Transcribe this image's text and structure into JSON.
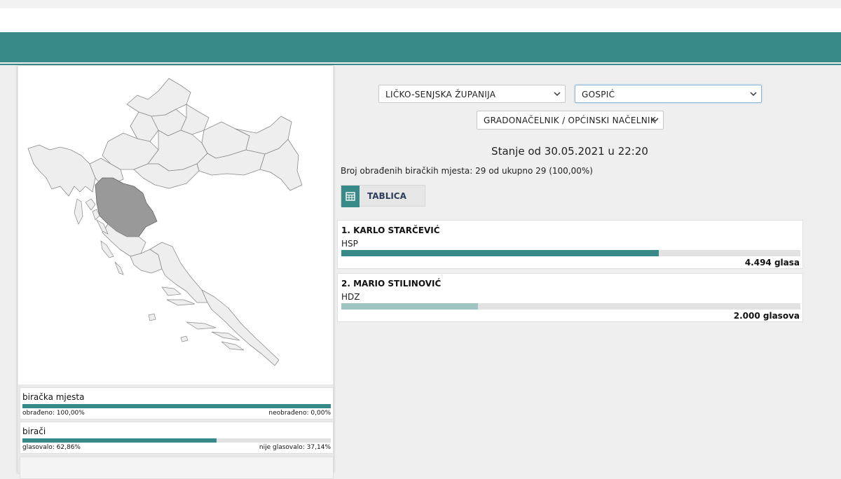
{
  "header": {
    "accent": "#378a87"
  },
  "filters": {
    "county": "LIČKO-SENJSKA ŽUPANIJA",
    "municipality": "GOSPIĆ",
    "election_type": "GRADONAČELNIK / OPĆINSKI NAČELNIK"
  },
  "status": {
    "as_of": "Stanje od 30.05.2021 u 22:20",
    "processed": "Broj obrađenih biračkih mjesta: 29 od ukupno 29 (100,00%)"
  },
  "view_toggle": {
    "label": "TABLICA",
    "icon": "table-icon"
  },
  "candidates": [
    {
      "name": "1. KARLO STARČEVIĆ",
      "party": "HSP",
      "votes": "4.494 glasa",
      "share": 0.692,
      "color": "#378a87"
    },
    {
      "name": "2. MARIO STILINOVIĆ",
      "party": "HDZ",
      "votes": "2.000 glasova",
      "share": 0.297,
      "color": "#9fc5c3"
    }
  ],
  "map": {
    "highlighted_region_color": "#999999",
    "region_color": "#eeeeee"
  },
  "stats": {
    "polling_stations": {
      "title": "biračka mjesta",
      "left": "obrađeno: 100,00%",
      "right": "neobrađeno: 0,00%",
      "fraction": 1.0
    },
    "voters": {
      "title": "birači",
      "left": "glasovalo: 62,86%",
      "right": "nije glasovalo: 37,14%",
      "fraction": 0.6286
    }
  }
}
